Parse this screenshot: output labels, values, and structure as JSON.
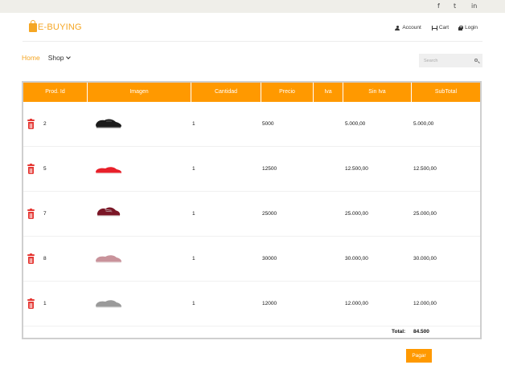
{
  "topbar": {
    "social": [
      "f",
      "t",
      "in"
    ]
  },
  "logo": {
    "text": "E-BUYING",
    "icon": "shopping-bag-icon"
  },
  "header": {
    "account_label": "Account",
    "cart_label": "Cart",
    "login_label": "Login"
  },
  "nav": {
    "home_label": "Home",
    "shop_label": "Shop"
  },
  "search": {
    "placeholder": "Search"
  },
  "table": {
    "columns": [
      "Prod. Id",
      "Imagen",
      "Cantidad",
      "Precio",
      "Iva",
      "Sin Iva",
      "SubTotal"
    ],
    "rows": [
      {
        "id": "2",
        "image": "black-sneaker",
        "cantidad": "1",
        "precio": "5000",
        "iva": "",
        "sin_iva": "5.000,00",
        "subtotal": "5.000,00"
      },
      {
        "id": "5",
        "image": "red-sneaker",
        "cantidad": "1",
        "precio": "12500",
        "iva": "",
        "sin_iva": "12.500,00",
        "subtotal": "12.500,00"
      },
      {
        "id": "7",
        "image": "maroon-sneaker",
        "cantidad": "1",
        "precio": "25000",
        "iva": "",
        "sin_iva": "25.000,00",
        "subtotal": "25.000,00"
      },
      {
        "id": "8",
        "image": "pink-sneaker",
        "cantidad": "1",
        "precio": "30000",
        "iva": "",
        "sin_iva": "30.000,00",
        "subtotal": "30.000,00"
      },
      {
        "id": "1",
        "image": "grey-sneaker",
        "cantidad": "1",
        "precio": "12000",
        "iva": "",
        "sin_iva": "12.000,00",
        "subtotal": "12.000,00"
      }
    ],
    "total_label": "Total:",
    "total_value": "84.500"
  },
  "pay_button": {
    "label": "Pagar"
  },
  "colors": {
    "accent": "#ff9900",
    "logo": "#f5a623",
    "delete": "#e53935",
    "topbar": "#efeee9"
  }
}
